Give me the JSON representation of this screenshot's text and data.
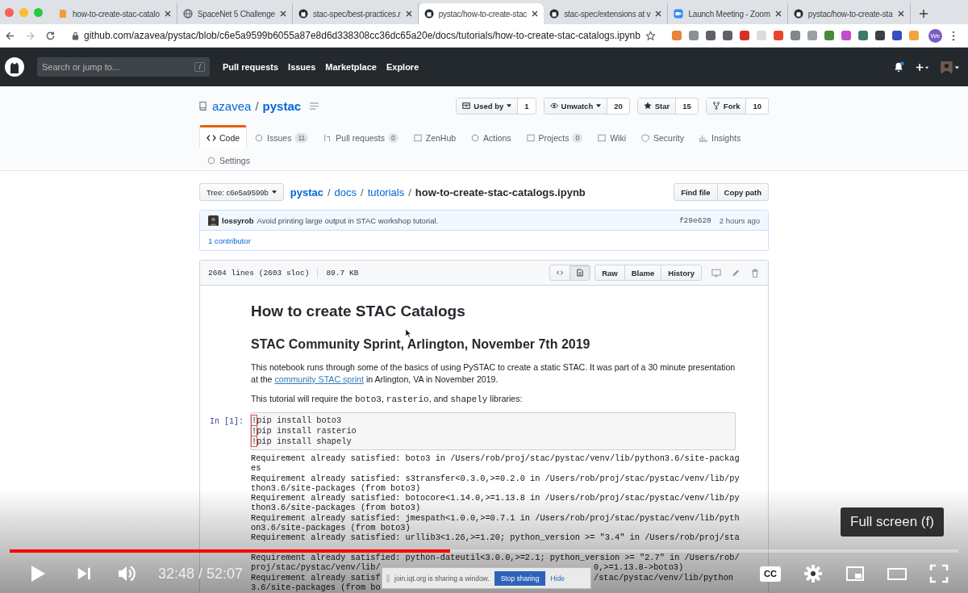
{
  "browser": {
    "tabs": [
      {
        "title": "how-to-create-stac-catalo",
        "kind": "doc",
        "selected": false
      },
      {
        "title": "SpaceNet 5 Challenge",
        "kind": "web",
        "selected": false
      },
      {
        "title": "stac-spec/best-practices.r",
        "kind": "repo",
        "selected": false
      },
      {
        "title": "pystac/how-to-create-stac",
        "kind": "repo",
        "selected": true
      },
      {
        "title": "stac-spec/extensions at v",
        "kind": "repo",
        "selected": false
      },
      {
        "title": "Launch Meeting - Zoom",
        "kind": "meeting",
        "selected": false
      },
      {
        "title": "pystac/how-to-create-sta",
        "kind": "repo",
        "selected": false
      }
    ],
    "url": "github.com/azavea/pystac/blob/c6e5a9599b6055a87e8d6d338308cc36dc65a20e/docs/tutorials/how-to-create-stac-catalogs.ipynb",
    "extensions": [
      {
        "color": "#e8833a"
      },
      {
        "color": "#8a8f96"
      },
      {
        "color": "#5f6368"
      },
      {
        "color": "#5f6368"
      },
      {
        "color": "#d93025"
      },
      {
        "color": "#dadce0"
      },
      {
        "color": "#e8452c"
      },
      {
        "color": "#80868b"
      },
      {
        "color": "#9aa0a6"
      },
      {
        "color": "#4a8a3a"
      },
      {
        "color": "#c44ad0"
      },
      {
        "color": "#3d7a6a"
      },
      {
        "color": "#3c4043"
      },
      {
        "color": "#3b4cc0"
      },
      {
        "color": "#f2a33a"
      }
    ],
    "profile": "We"
  },
  "github_header": {
    "search_placeholder": "Search or jump to...",
    "search_key": "/",
    "nav": [
      "Pull requests",
      "Issues",
      "Marketplace",
      "Explore"
    ]
  },
  "repo": {
    "owner": "azavea",
    "separator": "/",
    "name": "pystac",
    "actions": [
      {
        "label": "Used by",
        "count": "1",
        "kind": "used",
        "caret": true
      },
      {
        "label": "Unwatch",
        "count": "20",
        "kind": "watch",
        "caret": true
      },
      {
        "label": "Star",
        "count": "15",
        "kind": "star",
        "caret": false
      },
      {
        "label": "Fork",
        "count": "10",
        "kind": "fork",
        "caret": false
      }
    ],
    "tab_rows": [
      [
        {
          "label": "Code",
          "kind": "code",
          "selected": true
        },
        {
          "label": "Issues",
          "count": "11",
          "kind": "issues",
          "selected": false
        },
        {
          "label": "Pull requests",
          "count": "0",
          "kind": "pulls",
          "selected": false
        },
        {
          "label": "ZenHub",
          "kind": "zenhub",
          "selected": false
        },
        {
          "label": "Actions",
          "kind": "actions",
          "selected": false
        },
        {
          "label": "Projects",
          "count": "0",
          "kind": "projects",
          "selected": false
        },
        {
          "label": "Wiki",
          "kind": "wiki",
          "selected": false
        },
        {
          "label": "Security",
          "kind": "security",
          "selected": false
        },
        {
          "label": "Insights",
          "kind": "insights",
          "selected": false
        }
      ],
      [
        {
          "label": "Settings",
          "kind": "settings",
          "selected": false
        }
      ]
    ]
  },
  "file_nav": {
    "tree": "Tree: c6e5a9599b",
    "path": [
      {
        "name": "pystac",
        "separator": "/"
      },
      {
        "name": "docs",
        "separator": "/"
      },
      {
        "name": "tutorials",
        "separator": "/"
      }
    ],
    "file": "how-to-create-stac-catalogs.ipynb",
    "buttons": [
      "Find file",
      "Copy path"
    ]
  },
  "commit": {
    "author": "lossyrob",
    "message": "Avoid printing large output in STAC workshop tutorial.",
    "sha": "f29e620",
    "time": "2 hours ago",
    "contributors": "1 contributor"
  },
  "file_header": {
    "lines": "2604 lines (2603 sloc)",
    "size": "89.7 KB",
    "views": [
      {
        "kind": "code",
        "selected": false
      },
      {
        "kind": "rendered",
        "selected": true
      }
    ],
    "buttons": [
      "Raw",
      "Blame",
      "History"
    ]
  },
  "notebook": {
    "title": "How to create STAC Catalogs",
    "subtitle": "STAC Community Sprint, Arlington, November 7th 2019",
    "intro": {
      "before": "This notebook runs through some of the basics of using PySTAC to create a static STAC. It was part of a 30 minute presentation at the ",
      "link": "community STAC sprint",
      "after": " in Arlington, VA in November 2019."
    },
    "requires": [
      {
        "kind": "text",
        "text": "This tutorial will require the "
      },
      {
        "kind": "code",
        "text": "boto3"
      },
      {
        "kind": "text",
        "text": ", "
      },
      {
        "kind": "code",
        "text": "rasterio"
      },
      {
        "kind": "text",
        "text": ", and "
      },
      {
        "kind": "code",
        "text": "shapely"
      },
      {
        "kind": "text",
        "text": " libraries:"
      }
    ],
    "cell": {
      "prompt": "In [1]:",
      "lines": [
        {
          "mark": "!",
          "code": "pip install boto3"
        },
        {
          "mark": "!",
          "code": "pip install rasterio"
        },
        {
          "mark": "!",
          "code": "pip install shapely"
        }
      ]
    },
    "output": [
      {
        "parts": [
          "Requirement already satisfied: boto3 in /Users/rob/proj/stac/pystac/venv/lib/python3.6/site-packag"
        ]
      },
      {
        "parts": [
          "es"
        ]
      },
      {
        "parts": [
          "Requirement already satisfied: s3transfer<0.3.0,>=0.2.0 in /Users/rob/proj/stac/pystac/venv/lib/py"
        ]
      },
      {
        "parts": [
          "thon3.6/site-packages (from boto3)"
        ]
      },
      {
        "parts": [
          "Requirement already satisfied: botocore<1.14.0,>=1.13.8 in /Users/rob/proj/stac/pystac/venv/lib/py"
        ]
      },
      {
        "parts": [
          "thon3.6/site-packages (from boto3)"
        ]
      },
      {
        "parts": [
          "Requirement already satisfied: jmespath<1.0.0,>=0.7.1 in /Users/rob/proj/stac/pystac/venv/lib/pyth"
        ]
      },
      {
        "parts": [
          "on3.6/site-packages (from boto3)"
        ]
      },
      {
        "parts": [
          "Requirement already satisfied: urllib3<1.26,>=1.20; python_version >= \"3.4\" in /Users/rob/proj/sta"
        ]
      },
      {
        "parts": [
          "Requirement already satisfied: python-dateutil<3.0.0,>=2.1; python_version >= \"2.7\" in /Users/rob/"
        ]
      },
      {
        "parts": [
          "proj/stac/pystac/venv/lib/",
          "0,>=1.13.8->boto3)"
        ]
      },
      {
        "parts": [
          "Requirement already satisf",
          "/stac/pystac/venv/lib/python"
        ]
      },
      {
        "parts": [
          "3.6/site-packages (from bo"
        ]
      }
    ]
  },
  "player": {
    "progress": {
      "level": 0.464
    },
    "time": "32:48 / 52:07",
    "captions": "CC",
    "tooltip": "Full screen (f)"
  },
  "share_bar": {
    "message": "join.iqt.org is sharing a window.",
    "stop": "Stop sharing",
    "hide": "Hide"
  }
}
